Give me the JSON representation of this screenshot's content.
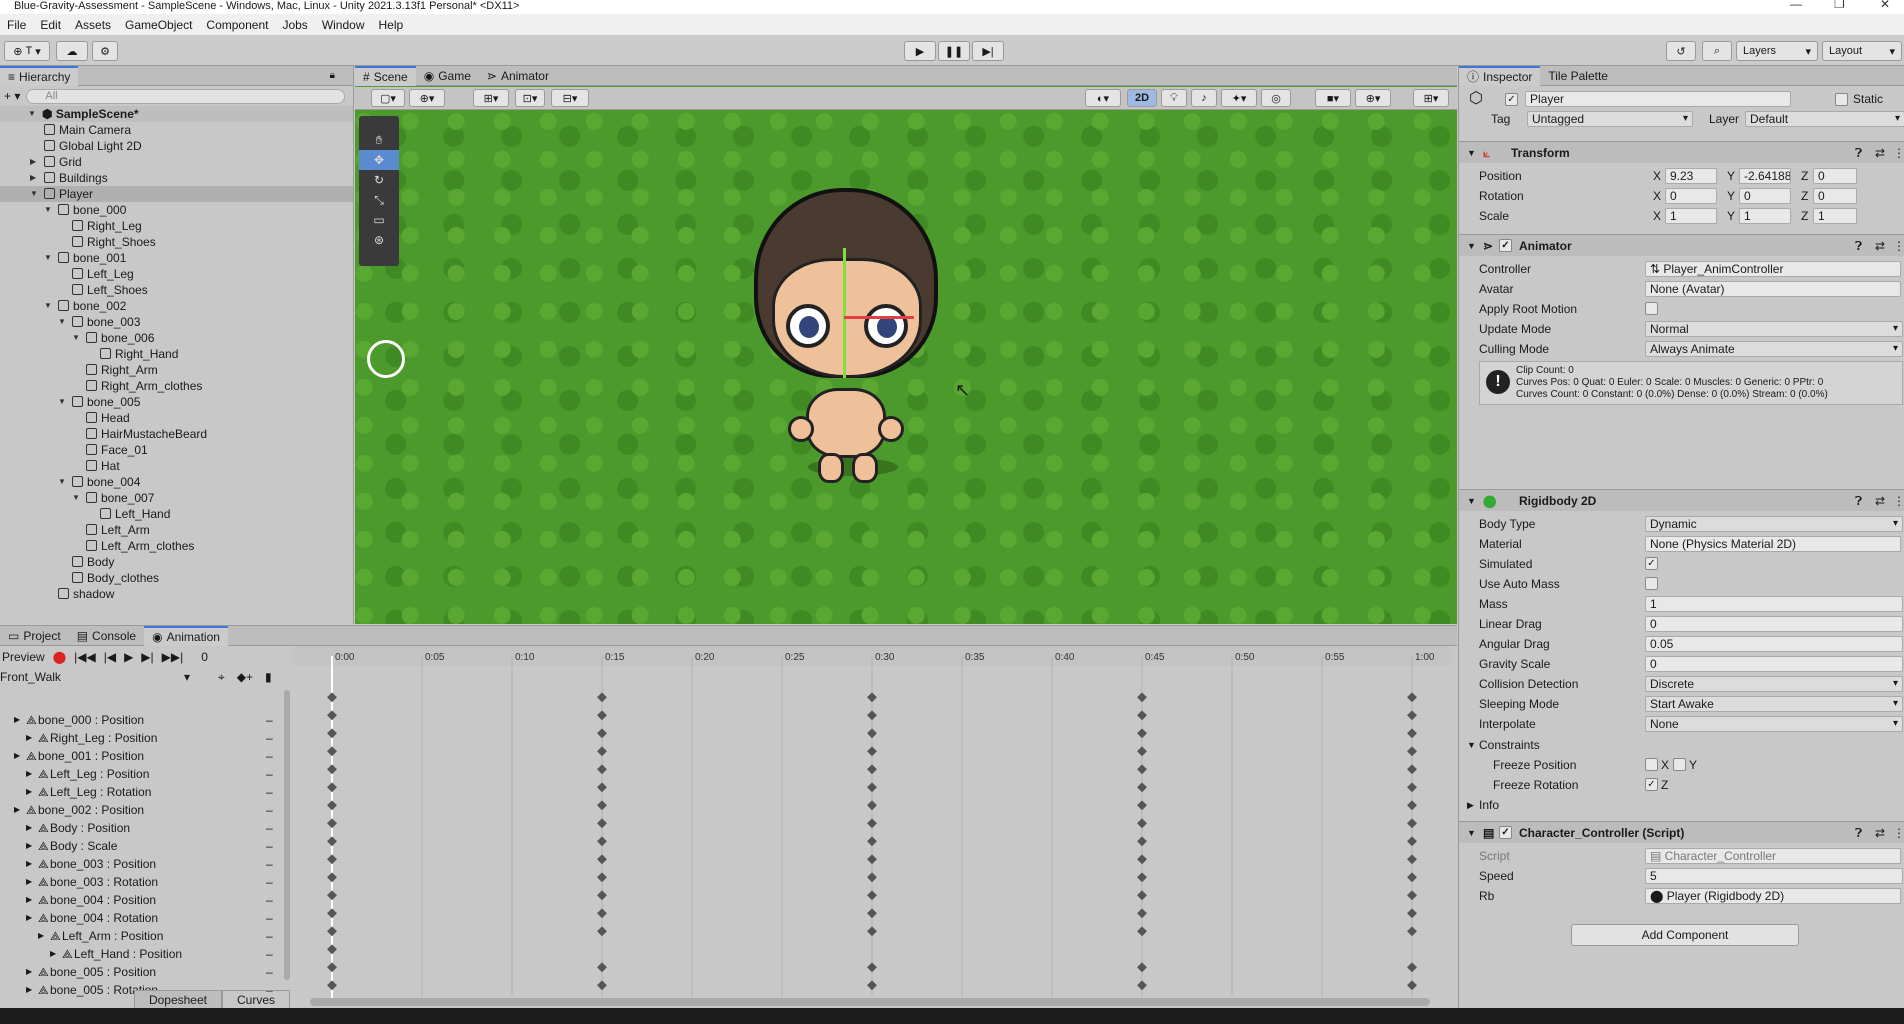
{
  "window": {
    "title": "Blue-Gravity-Assessment - SampleScene - Windows, Mac, Linux - Unity 2021.3.13f1 Personal* <DX11>"
  },
  "menu": [
    "File",
    "Edit",
    "Assets",
    "GameObject",
    "Component",
    "Jobs",
    "Window",
    "Help"
  ],
  "toolbar": {
    "account": "T",
    "layers": "Layers",
    "layout": "Layout"
  },
  "hierarchy": {
    "tab": "Hierarchy",
    "search_placeholder": "All",
    "scene": "SampleScene*",
    "items": [
      {
        "label": "Main Camera",
        "depth": 1,
        "arrow": ""
      },
      {
        "label": "Global Light 2D",
        "depth": 1,
        "arrow": ""
      },
      {
        "label": "Grid",
        "depth": 1,
        "arrow": "▶"
      },
      {
        "label": "Buildings",
        "depth": 1,
        "arrow": "▶"
      },
      {
        "label": "Player",
        "depth": 1,
        "arrow": "▼",
        "selected": true
      },
      {
        "label": "bone_000",
        "depth": 2,
        "arrow": "▼"
      },
      {
        "label": "Right_Leg",
        "depth": 3,
        "arrow": ""
      },
      {
        "label": "Right_Shoes",
        "depth": 3,
        "arrow": ""
      },
      {
        "label": "bone_001",
        "depth": 2,
        "arrow": "▼"
      },
      {
        "label": "Left_Leg",
        "depth": 3,
        "arrow": ""
      },
      {
        "label": "Left_Shoes",
        "depth": 3,
        "arrow": ""
      },
      {
        "label": "bone_002",
        "depth": 2,
        "arrow": "▼"
      },
      {
        "label": "bone_003",
        "depth": 3,
        "arrow": "▼"
      },
      {
        "label": "bone_006",
        "depth": 4,
        "arrow": "▼"
      },
      {
        "label": "Right_Hand",
        "depth": 5,
        "arrow": ""
      },
      {
        "label": "Right_Arm",
        "depth": 4,
        "arrow": ""
      },
      {
        "label": "Right_Arm_clothes",
        "depth": 4,
        "arrow": ""
      },
      {
        "label": "bone_005",
        "depth": 3,
        "arrow": "▼"
      },
      {
        "label": "Head",
        "depth": 4,
        "arrow": ""
      },
      {
        "label": "HairMustacheBeard",
        "depth": 4,
        "arrow": ""
      },
      {
        "label": "Face_01",
        "depth": 4,
        "arrow": ""
      },
      {
        "label": "Hat",
        "depth": 4,
        "arrow": ""
      },
      {
        "label": "bone_004",
        "depth": 3,
        "arrow": "▼"
      },
      {
        "label": "bone_007",
        "depth": 4,
        "arrow": "▼"
      },
      {
        "label": "Left_Hand",
        "depth": 5,
        "arrow": ""
      },
      {
        "label": "Left_Arm",
        "depth": 4,
        "arrow": ""
      },
      {
        "label": "Left_Arm_clothes",
        "depth": 4,
        "arrow": ""
      },
      {
        "label": "Body",
        "depth": 3,
        "arrow": ""
      },
      {
        "label": "Body_clothes",
        "depth": 3,
        "arrow": ""
      },
      {
        "label": "shadow",
        "depth": 2,
        "arrow": ""
      }
    ]
  },
  "scene": {
    "tabs": [
      "Scene",
      "Game",
      "Animator"
    ],
    "mode2d": "2D"
  },
  "inspector": {
    "tabs": [
      "Inspector",
      "Tile Palette"
    ],
    "object_name": "Player",
    "static_label": "Static",
    "tag_label": "Tag",
    "tag_value": "Untagged",
    "layer_label": "Layer",
    "layer_value": "Default",
    "transform": {
      "title": "Transform",
      "position_label": "Position",
      "rotation_label": "Rotation",
      "scale_label": "Scale",
      "pos": {
        "x": "9.23",
        "y": "-2.641883",
        "z": "0"
      },
      "rot": {
        "x": "0",
        "y": "0",
        "z": "0"
      },
      "scl": {
        "x": "1",
        "y": "1",
        "z": "1"
      }
    },
    "animator": {
      "title": "Animator",
      "controller_label": "Controller",
      "controller": "Player_AnimController",
      "avatar_label": "Avatar",
      "avatar": "None (Avatar)",
      "root_motion_label": "Apply Root Motion",
      "update_label": "Update Mode",
      "update": "Normal",
      "culling_label": "Culling Mode",
      "culling": "Always Animate",
      "info1": "Clip Count: 0",
      "info2": "Curves Pos: 0 Quat: 0 Euler: 0 Scale: 0 Muscles: 0 Generic: 0 PPtr: 0",
      "info3": "Curves Count: 0 Constant: 0 (0.0%) Dense: 0 (0.0%) Stream: 0 (0.0%)"
    },
    "rigidbody": {
      "title": "Rigidbody 2D",
      "rows": [
        {
          "label": "Body Type",
          "value": "Dynamic",
          "kind": "drop"
        },
        {
          "label": "Material",
          "value": "None (Physics Material 2D)",
          "kind": "obj"
        },
        {
          "label": "Simulated",
          "value": "✓",
          "kind": "chk"
        },
        {
          "label": "Use Auto Mass",
          "value": "",
          "kind": "chk"
        },
        {
          "label": "Mass",
          "value": "1",
          "kind": "fld"
        },
        {
          "label": "Linear Drag",
          "value": "0",
          "kind": "fld"
        },
        {
          "label": "Angular Drag",
          "value": "0.05",
          "kind": "fld"
        },
        {
          "label": "Gravity Scale",
          "value": "0",
          "kind": "fld"
        },
        {
          "label": "Collision Detection",
          "value": "Discrete",
          "kind": "drop"
        },
        {
          "label": "Sleeping Mode",
          "value": "Start Awake",
          "kind": "drop"
        },
        {
          "label": "Interpolate",
          "value": "None",
          "kind": "drop"
        }
      ],
      "constraints_label": "Constraints",
      "freeze_pos_label": "Freeze Position",
      "freeze_rot_label": "Freeze Rotation",
      "x": "X",
      "y": "Y",
      "z": "Z",
      "info_label": "Info"
    },
    "script": {
      "title": "Character_Controller (Script)",
      "script_label": "Script",
      "script": "Character_Controller",
      "speed_label": "Speed",
      "speed": "5",
      "rb_label": "Rb",
      "rb": "Player (Rigidbody 2D)"
    },
    "add_component": "Add Component"
  },
  "animation": {
    "tabs": [
      "Project",
      "Console",
      "Animation"
    ],
    "preview": "Preview",
    "frame": "0",
    "clip": "Front_Walk",
    "ticks": [
      "0:00",
      "0:05",
      "0:10",
      "0:15",
      "0:20",
      "0:25",
      "0:30",
      "0:35",
      "0:40",
      "0:45",
      "0:50",
      "0:55",
      "1:00"
    ],
    "props": [
      {
        "label": "bone_000 : Position",
        "indent": 0
      },
      {
        "label": "Right_Leg : Position",
        "indent": 1
      },
      {
        "label": "bone_001 : Position",
        "indent": 0
      },
      {
        "label": "Left_Leg : Position",
        "indent": 1
      },
      {
        "label": "Left_Leg : Rotation",
        "indent": 1
      },
      {
        "label": "bone_002 : Position",
        "indent": 0
      },
      {
        "label": "Body : Position",
        "indent": 1
      },
      {
        "label": "Body : Scale",
        "indent": 1
      },
      {
        "label": "bone_003 : Position",
        "indent": 1
      },
      {
        "label": "bone_003 : Rotation",
        "indent": 1
      },
      {
        "label": "bone_004 : Position",
        "indent": 1
      },
      {
        "label": "bone_004 : Rotation",
        "indent": 1
      },
      {
        "label": "Left_Arm : Position",
        "indent": 2
      },
      {
        "label": "Left_Hand : Position",
        "indent": 3
      },
      {
        "label": "bone_005 : Position",
        "indent": 1
      },
      {
        "label": "bone_005 : Rotation",
        "indent": 1
      }
    ],
    "dopesheet": "Dopesheet",
    "curves": "Curves"
  }
}
